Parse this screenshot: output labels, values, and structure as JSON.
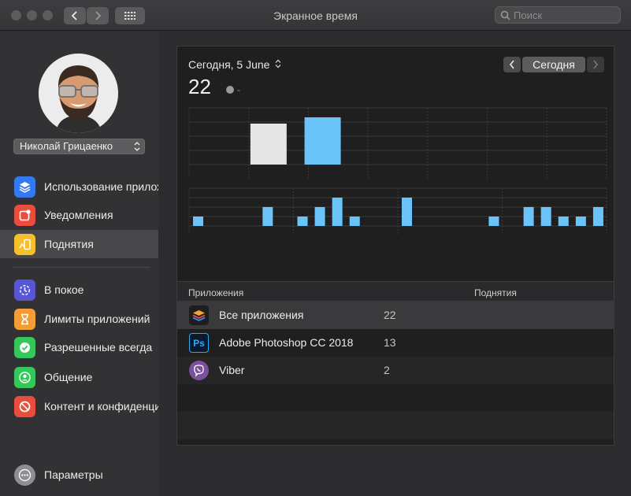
{
  "window": {
    "title": "Экранное время"
  },
  "search": {
    "placeholder": "Поиск"
  },
  "user": {
    "name": "Николай Грицаенко"
  },
  "sidebar": {
    "items": [
      {
        "label": "Использование прилож",
        "icon": "layers-icon",
        "color": "#3478f6"
      },
      {
        "label": "Уведомления",
        "icon": "notification-icon",
        "color": "#eb4d3d"
      },
      {
        "label": "Поднятия",
        "icon": "pickups-icon",
        "color": "#f5c02a",
        "selected": true
      },
      {
        "label": "В покое",
        "icon": "downtime-icon",
        "color": "#5856d6"
      },
      {
        "label": "Лимиты приложений",
        "icon": "hourglass-icon",
        "color": "#f29d38"
      },
      {
        "label": "Разрешенные всегда",
        "icon": "checkmark-badge-icon",
        "color": "#34c759"
      },
      {
        "label": "Общение",
        "icon": "contact-icon",
        "color": "#34c759"
      },
      {
        "label": "Контент и конфиденци",
        "icon": "restriction-icon",
        "color": "#eb4d3d"
      }
    ],
    "footer": {
      "label": "Параметры",
      "icon": "more-icon"
    }
  },
  "header": {
    "date_label": "Сегодня, 5 June",
    "total": "22",
    "delta": "-",
    "today_button": "Сегодня"
  },
  "colors": {
    "accent": "#6ac4fa",
    "previous": "#e5e5e5"
  },
  "chart_data": [
    {
      "type": "bar",
      "series": [
        {
          "values": [
            13
          ]
        },
        {
          "values": [
            15
          ]
        }
      ],
      "ylim": [
        0,
        18
      ],
      "grid": true
    },
    {
      "type": "bar",
      "x": [
        0,
        1,
        2,
        3,
        4,
        5,
        6,
        7,
        8,
        9,
        10,
        11,
        12,
        13,
        14,
        15,
        16,
        17,
        18,
        19,
        20,
        21,
        22,
        23
      ],
      "values": [
        1,
        0,
        0,
        0,
        2,
        0,
        1,
        2,
        3,
        1,
        0,
        0,
        3,
        0,
        0,
        0,
        0,
        1,
        0,
        2,
        2,
        1,
        1,
        2
      ],
      "ylim": [
        0,
        4
      ],
      "grid": true
    }
  ],
  "table": {
    "headers": [
      "Приложения",
      "Поднятия"
    ],
    "rows": [
      {
        "name": "Все приложения",
        "count": "22",
        "icon": "all-apps-icon"
      },
      {
        "name": "Adobe Photoshop CC 2018",
        "count": "13",
        "icon": "photoshop-icon"
      },
      {
        "name": "Viber",
        "count": "2",
        "icon": "viber-icon"
      }
    ]
  }
}
